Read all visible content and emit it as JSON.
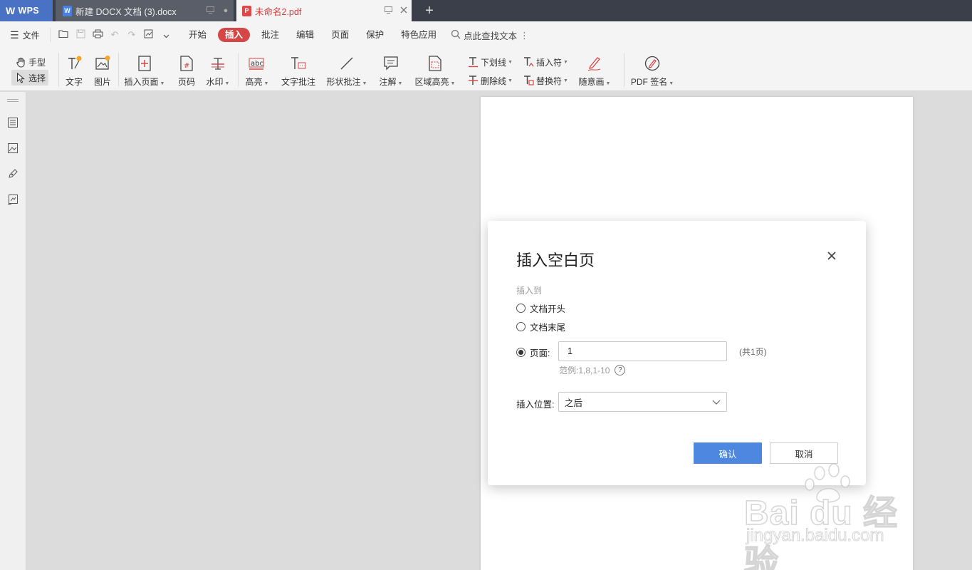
{
  "tabs": {
    "wps_label": "WPS",
    "doc_title": "新建 DOCX 文档 (3).docx",
    "pdf_title": "未命名2.pdf",
    "add_tab": "+"
  },
  "menubar": {
    "file": "文件",
    "tabs": [
      "开始",
      "插入",
      "批注",
      "编辑",
      "页面",
      "保护",
      "特色应用"
    ],
    "active_tab": "插入",
    "search": "点此查找文本"
  },
  "ribbon": {
    "hand": "手型",
    "select": "选择",
    "text": "文字",
    "image": "图片",
    "insert_page": "插入页面",
    "page_number": "页码",
    "watermark": "水印",
    "highlight": "高亮",
    "text_comment": "文字批注",
    "shape_comment": "形状批注",
    "annotation": "注解",
    "area_highlight": "区域高亮",
    "underline": "下划线",
    "strikethrough": "删除线",
    "insert_mark": "插入符",
    "replace_mark": "替换符",
    "freehand": "随意画",
    "pdf_sign": "PDF 签名"
  },
  "dialog": {
    "title": "插入空白页",
    "insert_to_label": "插入到",
    "option_start": "文档开头",
    "option_end": "文档末尾",
    "option_page": "页面:",
    "page_value": "1",
    "page_total": "(共1页)",
    "example": "范例:1,8,1-10",
    "position_label": "插入位置:",
    "position_value": "之后",
    "ok": "确认",
    "cancel": "取消"
  },
  "watermark": {
    "brand": "Bai du 经验",
    "url": "jingyan.baidu.com"
  },
  "colors": {
    "accent_red": "#d54646",
    "primary_blue": "#4d87e0",
    "tabbar": "#3b3f4a"
  }
}
